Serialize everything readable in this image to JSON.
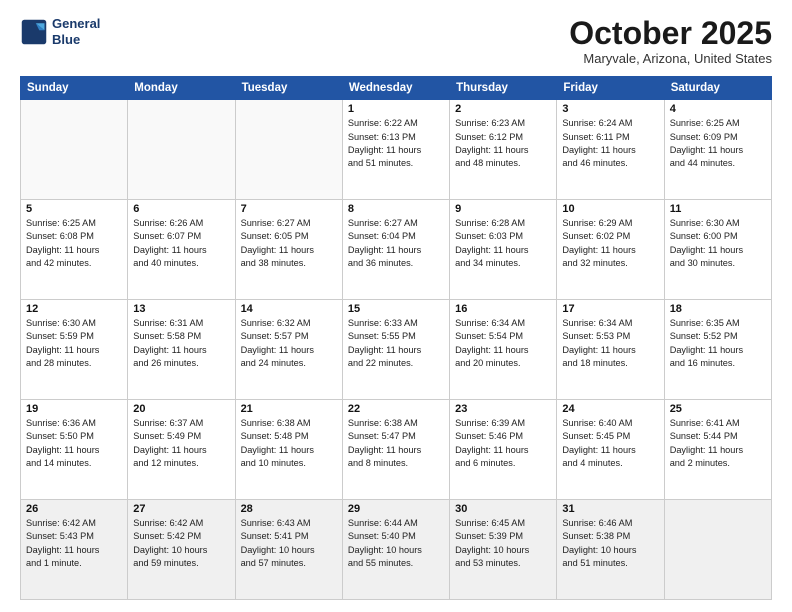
{
  "header": {
    "logo_line1": "General",
    "logo_line2": "Blue",
    "month": "October 2025",
    "location": "Maryvale, Arizona, United States"
  },
  "weekdays": [
    "Sunday",
    "Monday",
    "Tuesday",
    "Wednesday",
    "Thursday",
    "Friday",
    "Saturday"
  ],
  "weeks": [
    [
      {
        "day": "",
        "info": ""
      },
      {
        "day": "",
        "info": ""
      },
      {
        "day": "",
        "info": ""
      },
      {
        "day": "1",
        "info": "Sunrise: 6:22 AM\nSunset: 6:13 PM\nDaylight: 11 hours\nand 51 minutes."
      },
      {
        "day": "2",
        "info": "Sunrise: 6:23 AM\nSunset: 6:12 PM\nDaylight: 11 hours\nand 48 minutes."
      },
      {
        "day": "3",
        "info": "Sunrise: 6:24 AM\nSunset: 6:11 PM\nDaylight: 11 hours\nand 46 minutes."
      },
      {
        "day": "4",
        "info": "Sunrise: 6:25 AM\nSunset: 6:09 PM\nDaylight: 11 hours\nand 44 minutes."
      }
    ],
    [
      {
        "day": "5",
        "info": "Sunrise: 6:25 AM\nSunset: 6:08 PM\nDaylight: 11 hours\nand 42 minutes."
      },
      {
        "day": "6",
        "info": "Sunrise: 6:26 AM\nSunset: 6:07 PM\nDaylight: 11 hours\nand 40 minutes."
      },
      {
        "day": "7",
        "info": "Sunrise: 6:27 AM\nSunset: 6:05 PM\nDaylight: 11 hours\nand 38 minutes."
      },
      {
        "day": "8",
        "info": "Sunrise: 6:27 AM\nSunset: 6:04 PM\nDaylight: 11 hours\nand 36 minutes."
      },
      {
        "day": "9",
        "info": "Sunrise: 6:28 AM\nSunset: 6:03 PM\nDaylight: 11 hours\nand 34 minutes."
      },
      {
        "day": "10",
        "info": "Sunrise: 6:29 AM\nSunset: 6:02 PM\nDaylight: 11 hours\nand 32 minutes."
      },
      {
        "day": "11",
        "info": "Sunrise: 6:30 AM\nSunset: 6:00 PM\nDaylight: 11 hours\nand 30 minutes."
      }
    ],
    [
      {
        "day": "12",
        "info": "Sunrise: 6:30 AM\nSunset: 5:59 PM\nDaylight: 11 hours\nand 28 minutes."
      },
      {
        "day": "13",
        "info": "Sunrise: 6:31 AM\nSunset: 5:58 PM\nDaylight: 11 hours\nand 26 minutes."
      },
      {
        "day": "14",
        "info": "Sunrise: 6:32 AM\nSunset: 5:57 PM\nDaylight: 11 hours\nand 24 minutes."
      },
      {
        "day": "15",
        "info": "Sunrise: 6:33 AM\nSunset: 5:55 PM\nDaylight: 11 hours\nand 22 minutes."
      },
      {
        "day": "16",
        "info": "Sunrise: 6:34 AM\nSunset: 5:54 PM\nDaylight: 11 hours\nand 20 minutes."
      },
      {
        "day": "17",
        "info": "Sunrise: 6:34 AM\nSunset: 5:53 PM\nDaylight: 11 hours\nand 18 minutes."
      },
      {
        "day": "18",
        "info": "Sunrise: 6:35 AM\nSunset: 5:52 PM\nDaylight: 11 hours\nand 16 minutes."
      }
    ],
    [
      {
        "day": "19",
        "info": "Sunrise: 6:36 AM\nSunset: 5:50 PM\nDaylight: 11 hours\nand 14 minutes."
      },
      {
        "day": "20",
        "info": "Sunrise: 6:37 AM\nSunset: 5:49 PM\nDaylight: 11 hours\nand 12 minutes."
      },
      {
        "day": "21",
        "info": "Sunrise: 6:38 AM\nSunset: 5:48 PM\nDaylight: 11 hours\nand 10 minutes."
      },
      {
        "day": "22",
        "info": "Sunrise: 6:38 AM\nSunset: 5:47 PM\nDaylight: 11 hours\nand 8 minutes."
      },
      {
        "day": "23",
        "info": "Sunrise: 6:39 AM\nSunset: 5:46 PM\nDaylight: 11 hours\nand 6 minutes."
      },
      {
        "day": "24",
        "info": "Sunrise: 6:40 AM\nSunset: 5:45 PM\nDaylight: 11 hours\nand 4 minutes."
      },
      {
        "day": "25",
        "info": "Sunrise: 6:41 AM\nSunset: 5:44 PM\nDaylight: 11 hours\nand 2 minutes."
      }
    ],
    [
      {
        "day": "26",
        "info": "Sunrise: 6:42 AM\nSunset: 5:43 PM\nDaylight: 11 hours\nand 1 minute."
      },
      {
        "day": "27",
        "info": "Sunrise: 6:42 AM\nSunset: 5:42 PM\nDaylight: 10 hours\nand 59 minutes."
      },
      {
        "day": "28",
        "info": "Sunrise: 6:43 AM\nSunset: 5:41 PM\nDaylight: 10 hours\nand 57 minutes."
      },
      {
        "day": "29",
        "info": "Sunrise: 6:44 AM\nSunset: 5:40 PM\nDaylight: 10 hours\nand 55 minutes."
      },
      {
        "day": "30",
        "info": "Sunrise: 6:45 AM\nSunset: 5:39 PM\nDaylight: 10 hours\nand 53 minutes."
      },
      {
        "day": "31",
        "info": "Sunrise: 6:46 AM\nSunset: 5:38 PM\nDaylight: 10 hours\nand 51 minutes."
      },
      {
        "day": "",
        "info": ""
      }
    ]
  ]
}
